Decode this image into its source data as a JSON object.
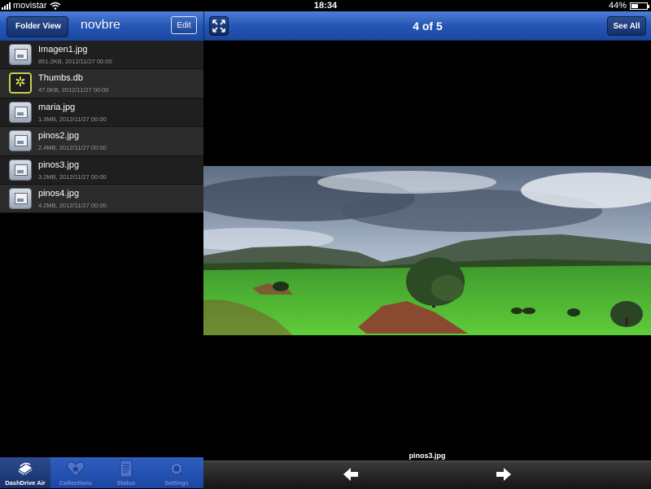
{
  "status_bar": {
    "carrier": "movistar",
    "time": "18:34",
    "battery": "44%",
    "battery_fraction": 0.44
  },
  "left_nav": {
    "back_label": "Folder View",
    "title": "novbre",
    "edit_label": "Edit"
  },
  "files": [
    {
      "name": "Imagen1.jpg",
      "meta": "851.2KB, 2012/11/27 00:00",
      "icon": "image-file-icon"
    },
    {
      "name": "Thumbs.db",
      "meta": "47.0KB, 2012/11/27 00:00",
      "icon": "database-file-icon"
    },
    {
      "name": "maria.jpg",
      "meta": "1.3MB, 2012/11/27 00:00",
      "icon": "image-file-icon"
    },
    {
      "name": "pinos2.jpg",
      "meta": "2.4MB, 2012/11/27 00:00",
      "icon": "image-file-icon"
    },
    {
      "name": "pinos3.jpg",
      "meta": "3.2MB, 2012/11/27 00:00",
      "icon": "image-file-icon"
    },
    {
      "name": "pinos4.jpg",
      "meta": "4.2MB, 2012/11/27 00:00",
      "icon": "image-file-icon"
    }
  ],
  "tabs": [
    {
      "label": "DashDrive Air",
      "icon": "drive-icon",
      "active": true
    },
    {
      "label": "Collections",
      "icon": "heart-star-icon",
      "active": false
    },
    {
      "label": "Status",
      "icon": "document-icon",
      "active": false
    },
    {
      "label": "Settings",
      "icon": "gear-icon",
      "active": false
    }
  ],
  "viewer": {
    "counter": "4 of 5",
    "see_all_label": "See All",
    "caption": "pinos3.jpg",
    "fullscreen_icon": "fullscreen-icon",
    "prev_icon": "arrow-left-icon",
    "next_icon": "arrow-right-icon"
  },
  "colors": {
    "nav_blue": "#2556b5",
    "tab_blue": "#2e5fc0",
    "list_row_dark": "#1f1f1f",
    "list_row_light": "#2b2b2b"
  }
}
